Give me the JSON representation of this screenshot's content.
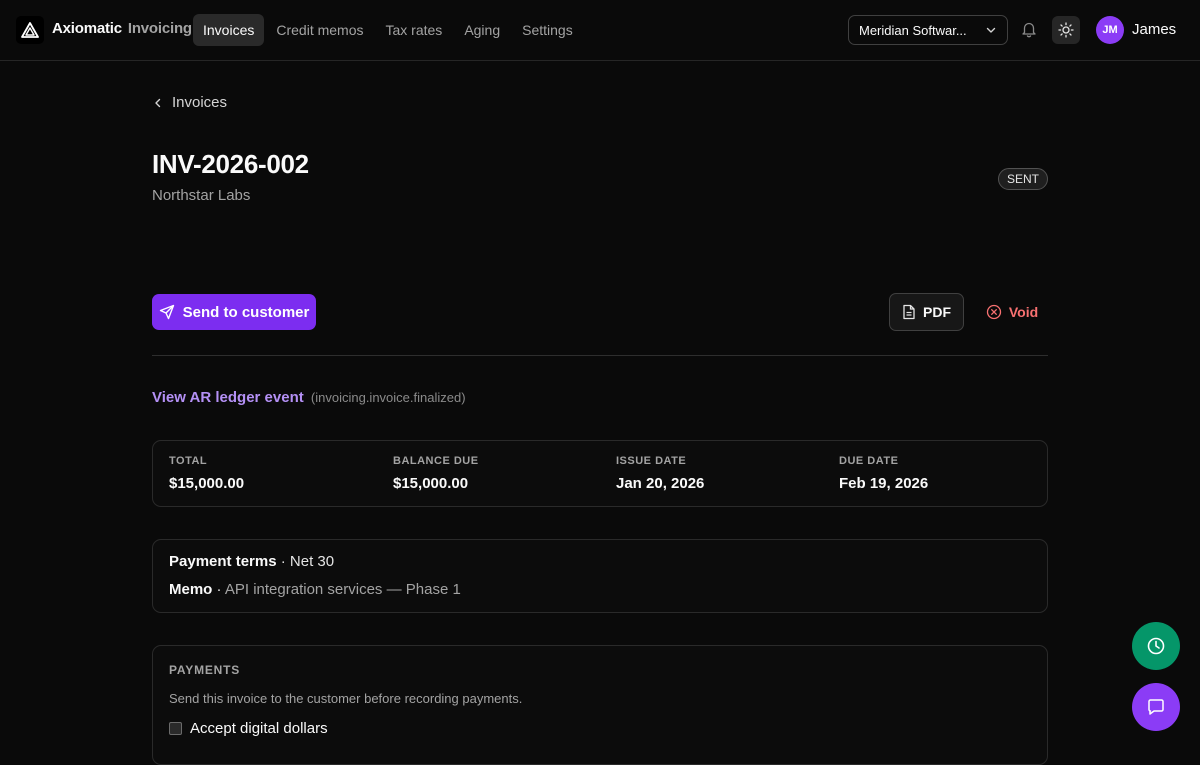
{
  "header": {
    "brand_name": "Axiomatic",
    "brand_sub": "Invoicing",
    "nav": [
      {
        "label": "Invoices",
        "active": true
      },
      {
        "label": "Credit memos",
        "active": false
      },
      {
        "label": "Tax rates",
        "active": false
      },
      {
        "label": "Aging",
        "active": false
      },
      {
        "label": "Settings",
        "active": false
      }
    ],
    "org_select_value": "Meridian Softwar...",
    "avatar_initials": "JM",
    "user_name": "James"
  },
  "page": {
    "back_label": "Invoices",
    "invoice_number": "INV-2026-002",
    "customer_name": "Northstar Labs",
    "status": "SENT",
    "send_button": "Send to customer",
    "pdf_button": "PDF",
    "void_button": "Void",
    "ledger_link": "View AR ledger event",
    "ledger_code": "(invoicing.invoice.finalized)"
  },
  "summary": [
    {
      "label": "TOTAL",
      "value": "$15,000.00"
    },
    {
      "label": "BALANCE DUE",
      "value": "$15,000.00"
    },
    {
      "label": "ISSUE DATE",
      "value": "Jan 20, 2026"
    },
    {
      "label": "DUE DATE",
      "value": "Feb 19, 2026"
    }
  ],
  "terms": {
    "payment_terms_label": "Payment terms",
    "payment_terms_value": "Net 30",
    "memo_label": "Memo",
    "memo_value": "API integration services — Phase 1",
    "separator": "·"
  },
  "payments": {
    "title": "PAYMENTS",
    "note": "Send this invoice to the customer before recording payments.",
    "accept_digital_label": "Accept digital dollars",
    "accept_digital_checked": false
  },
  "colors": {
    "accent": "#7c2df0",
    "void": "#f87171",
    "history_fab": "#059669",
    "chat_fab": "#8b3cf6",
    "link": "#b490f5"
  }
}
